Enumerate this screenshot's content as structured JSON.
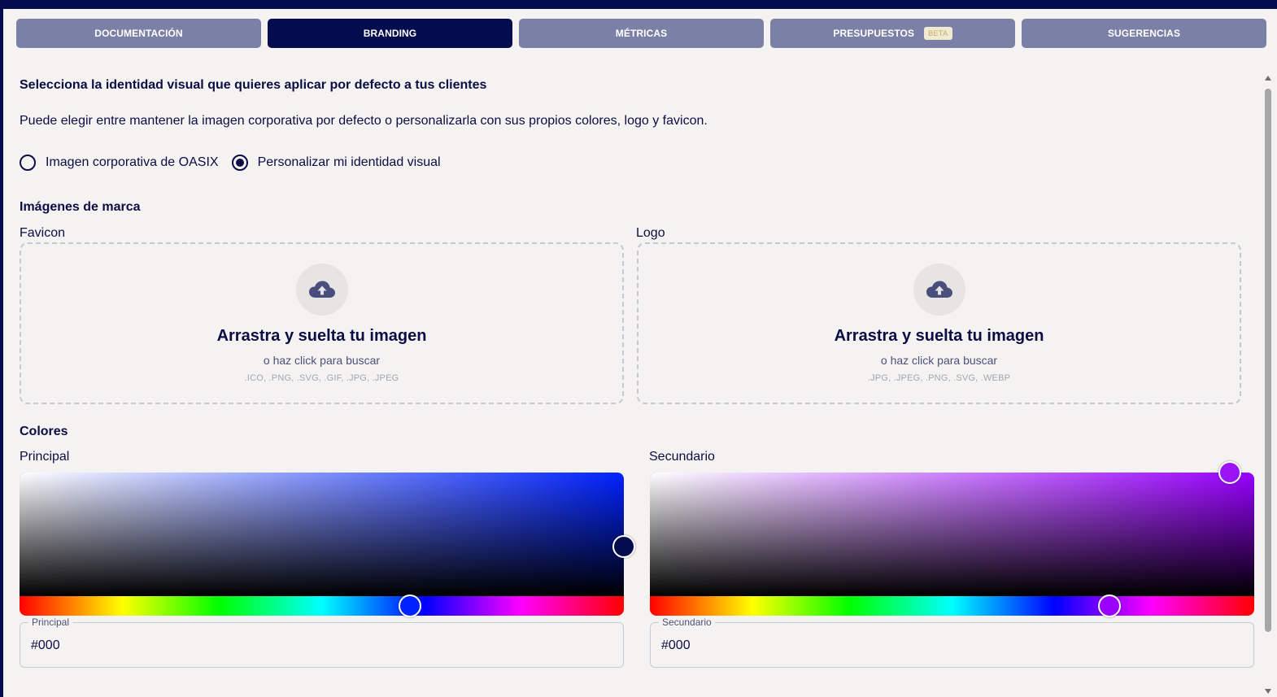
{
  "tabs": [
    {
      "label": "DOCUMENTACIÓN",
      "active": false
    },
    {
      "label": "BRANDING",
      "active": true
    },
    {
      "label": "MÉTRICAS",
      "active": false
    },
    {
      "label": "PRESUPUESTOS",
      "badge": "BETA",
      "active": false
    },
    {
      "label": "SUGERENCIAS",
      "active": false
    }
  ],
  "branding": {
    "heading": "Selecciona la identidad visual que quieres aplicar por defecto a tus clientes",
    "description": "Puede elegir entre mantener la imagen corporativa por defecto o personalizarla con sus propios colores, logo y favicon.",
    "options": [
      {
        "label": "Imagen corporativa de OASIX",
        "selected": false
      },
      {
        "label": "Personalizar mi identidad visual",
        "selected": true
      }
    ]
  },
  "images": {
    "heading": "Imágenes de marca",
    "favicon": {
      "label": "Favicon",
      "title": "Arrastra y suelta tu imagen",
      "subtitle": "o haz click para buscar",
      "formats": ".ICO, .PNG, .SVG, .GIF, .JPG, .JPEG",
      "icon": "cloud-upload-icon"
    },
    "logo": {
      "label": "Logo",
      "title": "Arrastra y suelta tu imagen",
      "subtitle": "o haz click para buscar",
      "formats": ".JPG, .JPEG, .PNG, .SVG, .WEBP",
      "icon": "cloud-upload-icon"
    }
  },
  "colors": {
    "heading": "Colores",
    "principal": {
      "label": "Principal",
      "field_label": "Principal",
      "value": "#000",
      "hue_color": "#0022ff",
      "handle_color": "#050b4f",
      "hue_fraction": 0.646,
      "saturation_fraction": 1.0,
      "brightness_fraction": 0.4
    },
    "secundario": {
      "label": "Secundario",
      "field_label": "Secundario",
      "value": "#000",
      "hue_color": "#9900ff",
      "handle_color": "#9b14f5",
      "hue_fraction": 0.76,
      "saturation_fraction": 0.96,
      "brightness_fraction": 1.0
    }
  },
  "theme": {
    "navy": "#050b4f",
    "tab_inactive": "#7b80a6",
    "background": "#f4f3f1",
    "beta_badge_bg": "#f0ead0"
  }
}
